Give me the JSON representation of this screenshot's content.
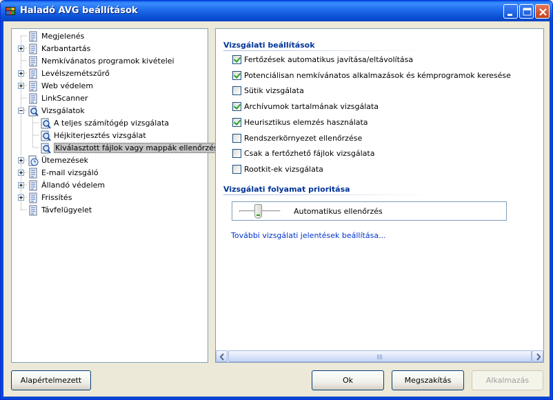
{
  "window": {
    "title": "Haladó AVG beállítások"
  },
  "tree": {
    "items": [
      {
        "label": "Megjelenés"
      },
      {
        "label": "Karbantartás"
      },
      {
        "label": "Nemkívánatos programok kivételei"
      },
      {
        "label": "Levélszemétszűrő"
      },
      {
        "label": "Web védelem"
      },
      {
        "label": "LinkScanner"
      },
      {
        "label": "Vizsgálatok"
      },
      {
        "label": "A teljes számítógép vizsgálata"
      },
      {
        "label": "Héjkiterjesztés vizsgálat"
      },
      {
        "label": "Kiválasztott fájlok vagy mappák ellenőrzése"
      },
      {
        "label": "Ütemezések"
      },
      {
        "label": "E-mail vizsgáló"
      },
      {
        "label": "Állandó védelem"
      },
      {
        "label": "Frissítés"
      },
      {
        "label": "Távfelügyelet"
      }
    ]
  },
  "settings": {
    "section_title": "Vizsgálati beállítások",
    "options": [
      {
        "label": "Fertőzések automatikus javítása/eltávolítása",
        "checked": true
      },
      {
        "label": "Potenciálisan nemkívánatos alkalmazások és kémprogramok keresése",
        "checked": true
      },
      {
        "label": "Sütik vizsgálata",
        "checked": false
      },
      {
        "label": "Archívumok tartalmának vizsgálata",
        "checked": true
      },
      {
        "label": "Heurisztikus elemzés használata",
        "checked": true
      },
      {
        "label": "Rendszerkörnyezet ellenőrzése",
        "checked": false
      },
      {
        "label": "Csak a fertőzhető fájlok vizsgálata",
        "checked": false
      },
      {
        "label": "Rootkit-ek vizsgálata",
        "checked": false
      }
    ],
    "priority_title": "Vizsgálati folyamat prioritása",
    "priority_label": "Automatikus ellenőrzés",
    "report_link": "További vizsgálati jelentések beállítása..."
  },
  "buttons": {
    "defaults": "Alapértelmezett",
    "ok": "Ok",
    "cancel": "Megszakítás",
    "apply": "Alkalmazás"
  },
  "colors": {
    "titlebar": "#0A5FE6",
    "section_title": "#003399",
    "link": "#0033CC",
    "check": "#21A121"
  }
}
